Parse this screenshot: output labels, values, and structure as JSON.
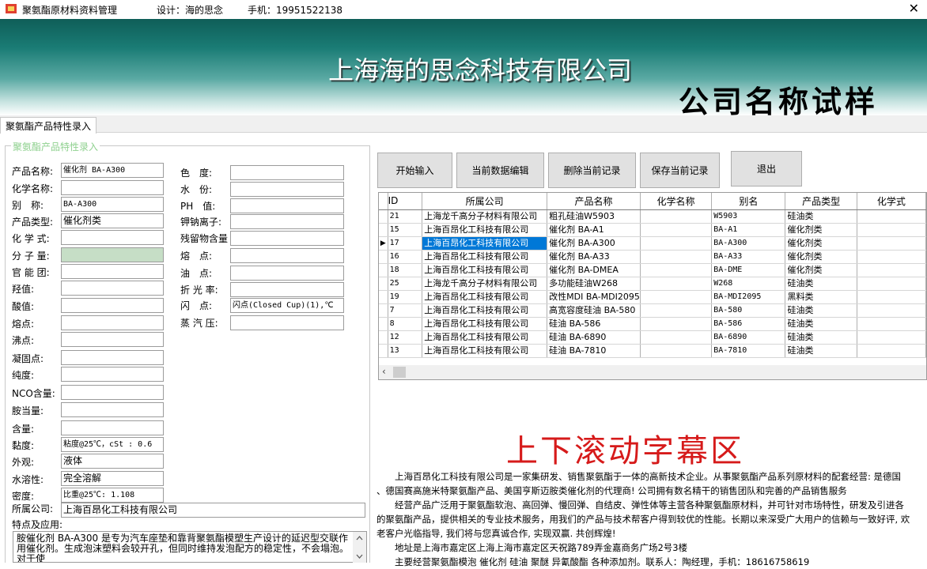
{
  "titlebar": {
    "app_title": "聚氨酯原材料资料管理",
    "designer": "设计：海的思念",
    "phone": "手机：19951522138",
    "close_glyph": "✕"
  },
  "banner": {
    "company_name": "上海海的思念科技有限公司",
    "sample_text": "公司名称试样"
  },
  "tab": {
    "label": "聚氨酯产品特性录入"
  },
  "group": {
    "legend": "聚氨酯产品特性录入"
  },
  "form_left": [
    {
      "label": "产品名称:",
      "value": "催化剂 BA-A300"
    },
    {
      "label": "化学名称:",
      "value": ""
    },
    {
      "label": "别　称:",
      "value": "BA-A300"
    },
    {
      "label": "产品类型:",
      "value": "催化剂类"
    },
    {
      "label": "化 学 式:",
      "value": ""
    },
    {
      "label": "分 子 量:",
      "value": ""
    },
    {
      "label": "官 能 团:",
      "value": ""
    },
    {
      "label": "羟值:",
      "value": ""
    },
    {
      "label": "酸值:",
      "value": ""
    },
    {
      "label": "熔点:",
      "value": ""
    },
    {
      "label": "沸点:",
      "value": ""
    },
    {
      "label": "凝固点:",
      "value": ""
    },
    {
      "label": "纯度:",
      "value": ""
    },
    {
      "label": "NCO含量:",
      "value": ""
    },
    {
      "label": "胺当量:",
      "value": ""
    },
    {
      "label": "含量:",
      "value": ""
    },
    {
      "label": "黏度:",
      "value": "粘度@25℃，cSt : 0.6"
    },
    {
      "label": "外观:",
      "value": "液体"
    },
    {
      "label": "水溶性:",
      "value": "完全溶解"
    },
    {
      "label": "密度:",
      "value": "比重@25℃:  1.108"
    }
  ],
  "form_right": [
    {
      "label": "色　度:",
      "value": ""
    },
    {
      "label": "水　份:",
      "value": ""
    },
    {
      "label": "PH　值:",
      "value": ""
    },
    {
      "label": "钾钠离子:",
      "value": ""
    },
    {
      "label": "残留物含量",
      "value": ""
    },
    {
      "label": "熔　点:",
      "value": ""
    },
    {
      "label": "油　点:",
      "value": ""
    },
    {
      "label": "折 光 率:",
      "value": ""
    },
    {
      "label": "闪　点:",
      "value": "闪点(Closed Cup)(1),℃"
    },
    {
      "label": "蒸 汽 压:",
      "value": ""
    }
  ],
  "owner": {
    "label": "所属公司:",
    "value": "上海百昂化工科技有限公司"
  },
  "features": {
    "label": "特点及应用:",
    "text": "胺催化剂 BA-A300 是专为汽车座垫和靠背聚氨酯模塑生产设计的延迟型交联作用催化剂。生成泡沫塑料会较开孔，但同时维持发泡配方的稳定性，不会塌泡。对于使"
  },
  "buttons": {
    "start_input": "开始输入",
    "edit_current": "当前数据编辑",
    "delete_current": "删除当前记录",
    "save_current": "保存当前记录",
    "exit": "退出"
  },
  "grid": {
    "columns": [
      "ID",
      "所属公司",
      "产品名称",
      "化学名称",
      "别名",
      "产品类型",
      "化学式"
    ],
    "selected_row_index": 2,
    "rows": [
      [
        "21",
        "上海龙千高分子材料有限公司",
        "粗孔硅油W5903",
        "",
        "W5903",
        "硅油类"
      ],
      [
        "15",
        "上海百昂化工科技有限公司",
        "催化剂 BA-A1",
        "",
        "BA-A1",
        "催化剂类"
      ],
      [
        "17",
        "上海百昂化工科技有限公司",
        "催化剂 BA-A300",
        "",
        "BA-A300",
        "催化剂类"
      ],
      [
        "16",
        "上海百昂化工科技有限公司",
        "催化剂 BA-A33",
        "",
        "BA-A33",
        "催化剂类"
      ],
      [
        "18",
        "上海百昂化工科技有限公司",
        "催化剂 BA-DMEA",
        "",
        "BA-DME",
        "催化剂类"
      ],
      [
        "25",
        "上海龙千高分子材料有限公司",
        "多功能硅油W268",
        "",
        "W268",
        "硅油类"
      ],
      [
        "19",
        "上海百昂化工科技有限公司",
        "改性MDI BA-MDI2095",
        "",
        "BA-MDI2095",
        "黑料类"
      ],
      [
        "7",
        "上海百昂化工科技有限公司",
        "高宽容度硅油 BA-580",
        "",
        "BA-580",
        "硅油类"
      ],
      [
        "8",
        "上海百昂化工科技有限公司",
        "硅油 BA-586",
        "",
        "BA-586",
        "硅油类"
      ],
      [
        "12",
        "上海百昂化工科技有限公司",
        "硅油 BA-6890",
        "",
        "BA-6890",
        "硅油类"
      ],
      [
        "13",
        "上海百昂化工科技有限公司",
        "硅油 BA-7810",
        "",
        "BA-7810",
        "硅油类"
      ]
    ]
  },
  "marquee": {
    "title": "上下滚动字幕区",
    "lines": [
      "　　上海百昂化工科技有限公司是一家集研发、销售聚氨酯于一体的高新技术企业。从事聚氨酯产品系列原材料的配套经营: 是德国",
      "、德国赛高施米特聚氨酯产品、美国亨斯迈胺类催化剂的代理商! 公司拥有数名精干的销售团队和完善的产品销售服务",
      "　　经营产品广泛用于聚氨酯软泡、高回弹、慢回弹、自结皮、弹性体等主营各种聚氨酯原材料，并可针对市场特性，研发及引进各",
      "的聚氨酯产品，提供相关的专业技术服务，用我们的产品与技术帮客户得到较优的性能。长期以来深受广大用户的信赖与一致好评, 欢",
      "老客户光临指导, 我们将与您真诚合作, 实现双赢. 共创辉煌!",
      "　　地址是上海市嘉定区上海上海市嘉定区天祝路789弄金嘉商务广场2号3楼",
      "　　主要经营聚氨酯模泡 催化剂 硅油 聚醚 异氰酸酯 各种添加剂。联系人：陶经理，手机：18616758619"
    ]
  },
  "colors": {
    "selection": "#0078d7",
    "marquee_title": "#d61a1a",
    "legend": "#8fd18f",
    "banner_dark": "#0f5e58"
  }
}
